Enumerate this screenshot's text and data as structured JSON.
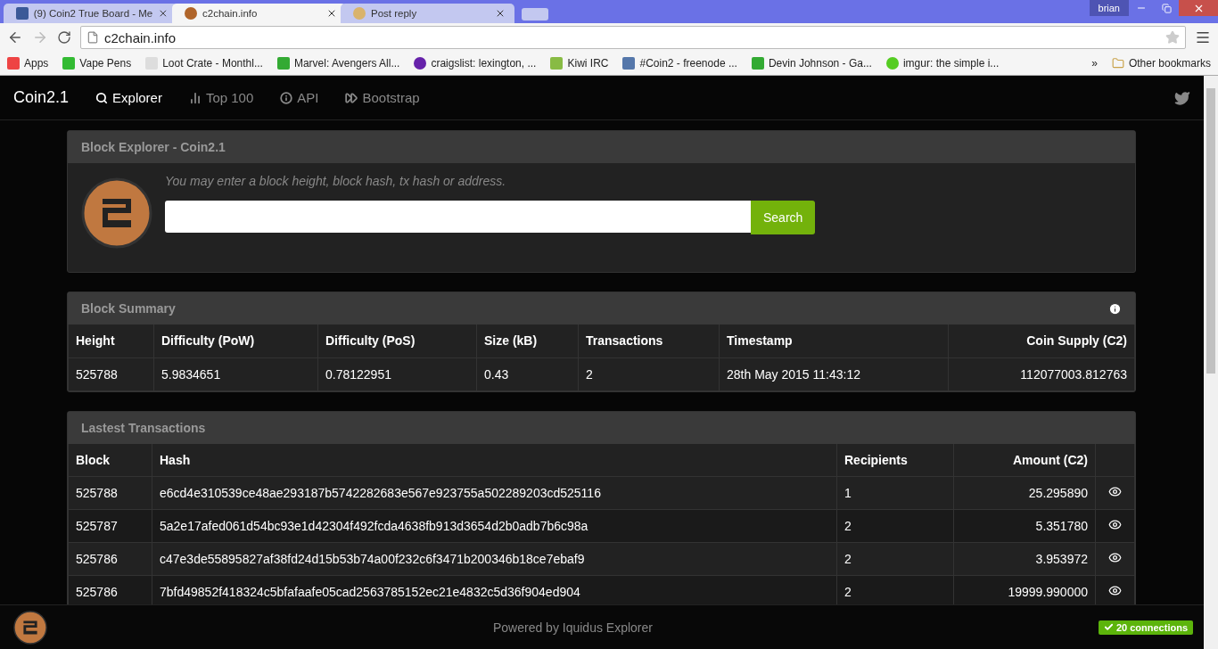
{
  "browser": {
    "tabs": [
      {
        "title": "(9) Coin2 True Board - Me",
        "selected": false
      },
      {
        "title": "c2chain.info",
        "selected": true
      },
      {
        "title": "Post reply",
        "selected": false
      }
    ],
    "profile": "brian",
    "address": "c2chain.info",
    "bookmarks": [
      "Apps",
      "Vape Pens",
      "Loot Crate - Monthl...",
      "Marvel: Avengers All...",
      "craigslist: lexington, ...",
      "Kiwi IRC",
      "#Coin2 - freenode ...",
      "Devin Johnson - Ga...",
      "imgur: the simple i..."
    ],
    "more": "»",
    "other_bookmarks": "Other bookmarks"
  },
  "navbar": {
    "brand": "Coin2.1",
    "items": [
      {
        "label": "Explorer",
        "selected": true
      },
      {
        "label": "Top 100",
        "selected": false
      },
      {
        "label": "API",
        "selected": false
      },
      {
        "label": "Bootstrap",
        "selected": false
      }
    ]
  },
  "search_panel": {
    "title": "Block Explorer - Coin2.1",
    "hint": "You may enter a block height, block hash, tx hash or address.",
    "button": "Search"
  },
  "summary": {
    "title": "Block Summary",
    "columns": [
      "Height",
      "Difficulty (PoW)",
      "Difficulty (PoS)",
      "Size (kB)",
      "Transactions",
      "Timestamp",
      "Coin Supply (C2)"
    ],
    "row": [
      "525788",
      "5.9834651",
      "0.78122951",
      "0.43",
      "2",
      "28th May 2015 11:43:12",
      "112077003.812763"
    ]
  },
  "transactions": {
    "title": "Lastest Transactions",
    "columns": [
      "Block",
      "Hash",
      "Recipients",
      "Amount (C2)"
    ],
    "rows": [
      [
        "525788",
        "e6cd4e310539ce48ae293187b5742282683e567e923755a502289203cd525116",
        "1",
        "25.295890"
      ],
      [
        "525787",
        "5a2e17afed061d54bc93e1d42304f492fcda4638fb913d3654d2b0adb7b6c98a",
        "2",
        "5.351780"
      ],
      [
        "525786",
        "c47e3de55895827af38fd24d15b53b74a00f232c6f3471b200346b18ce7ebaf9",
        "2",
        "3.953972"
      ],
      [
        "525786",
        "7bfd49852f418324c5bfafaafe05cad2563785152ec21e4832c5d36f904ed904",
        "2",
        "19999.990000"
      ]
    ]
  },
  "footer": {
    "text": "Powered by Iquidus Explorer",
    "connections": "20 connections"
  }
}
